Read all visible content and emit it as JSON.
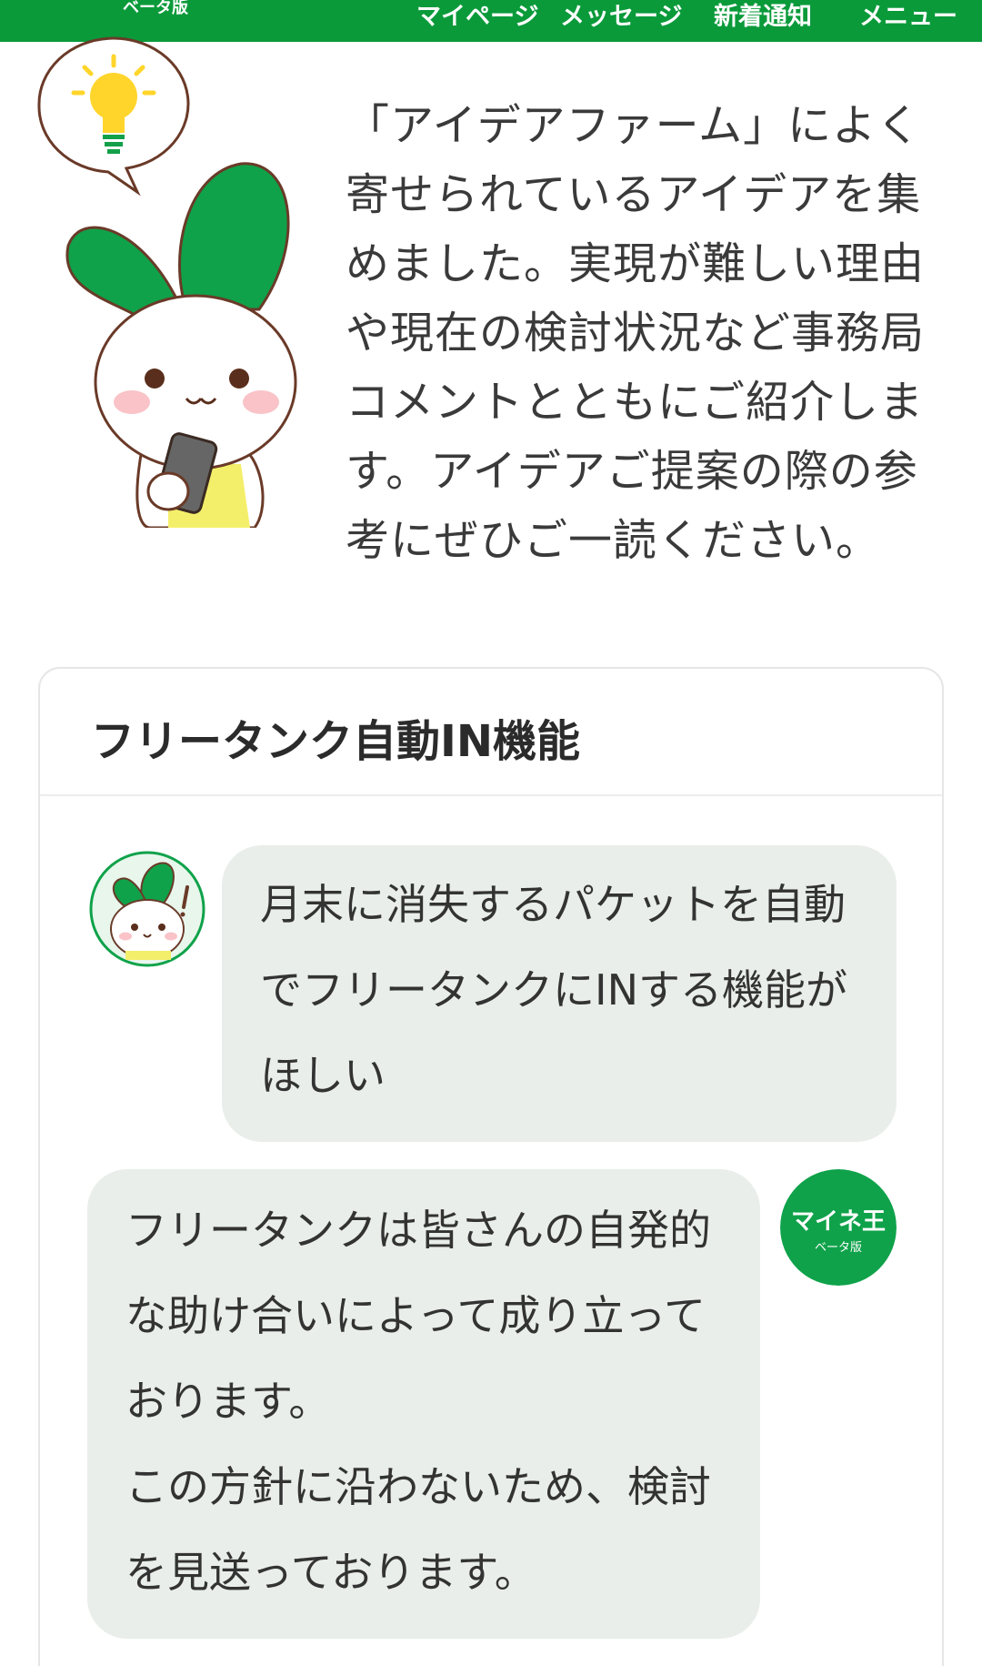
{
  "header": {
    "beta_label": "ベータ版",
    "nav": [
      "マイページ",
      "メッセージ",
      "新着通知",
      "メニュー"
    ]
  },
  "intro": {
    "text": "「アイデアファーム」によく寄せられているアイデアを集めました。実現が難しい理由や現在の検討状況など事務局コメントとともにご紹介します。アイデアご提案の際の参考にぜひご一読ください。"
  },
  "card": {
    "title": "フリータンク自動IN機能",
    "user_message": "月末に消失するパケットを自動でフリータンクにINする機能がほしい",
    "admin_reply_line1": "フリータンクは皆さんの自発的な助け合いによって成り立っております。",
    "admin_reply_line2": "この方針に沿わないため、検討を見送っております。",
    "admin_logo_text": "マイネ王",
    "admin_logo_sub": "ベータ版"
  },
  "colors": {
    "brand_green": "#0a9a3a",
    "bubble_bg": "#e9eeea"
  },
  "icons": [
    "lightbulb-icon",
    "rabbit-mascot",
    "mineo-logo"
  ]
}
